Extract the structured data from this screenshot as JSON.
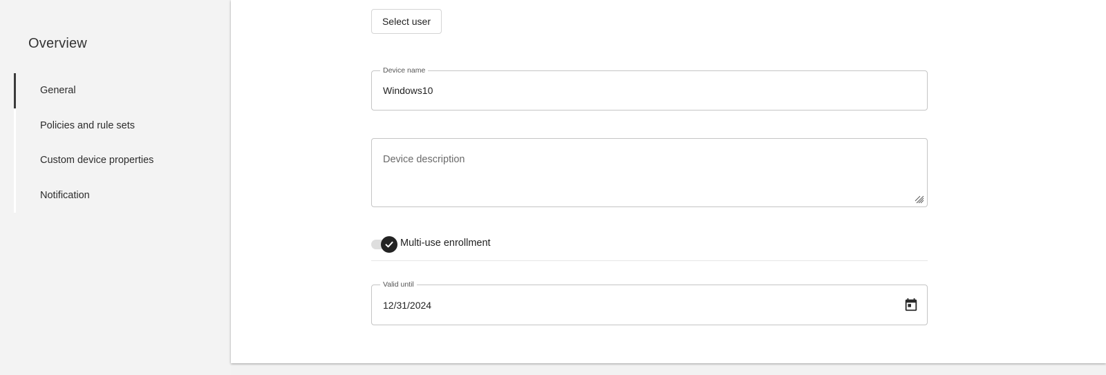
{
  "sidebar": {
    "title": "Overview",
    "items": [
      {
        "label": "General",
        "active": true
      },
      {
        "label": "Policies and rule sets",
        "active": false
      },
      {
        "label": "Custom device properties",
        "active": false
      },
      {
        "label": "Notification",
        "active": false
      }
    ]
  },
  "main": {
    "select_user_label": "Select user",
    "device_name": {
      "label": "Device name",
      "value": "Windows10"
    },
    "device_description": {
      "placeholder": "Device description",
      "value": ""
    },
    "multi_use_enrollment": {
      "label": "Multi-use enrollment",
      "checked": true
    },
    "valid_until": {
      "label": "Valid until",
      "value": "12/31/2024"
    }
  },
  "icons": {
    "toggle_check": "check-icon",
    "resize": "resize-handle-icon",
    "date_picker": "calendar-icon"
  },
  "colors": {
    "accent": "#232323",
    "nav_active_indicator": "#3a3a3a",
    "background": "#f3f3f3"
  }
}
